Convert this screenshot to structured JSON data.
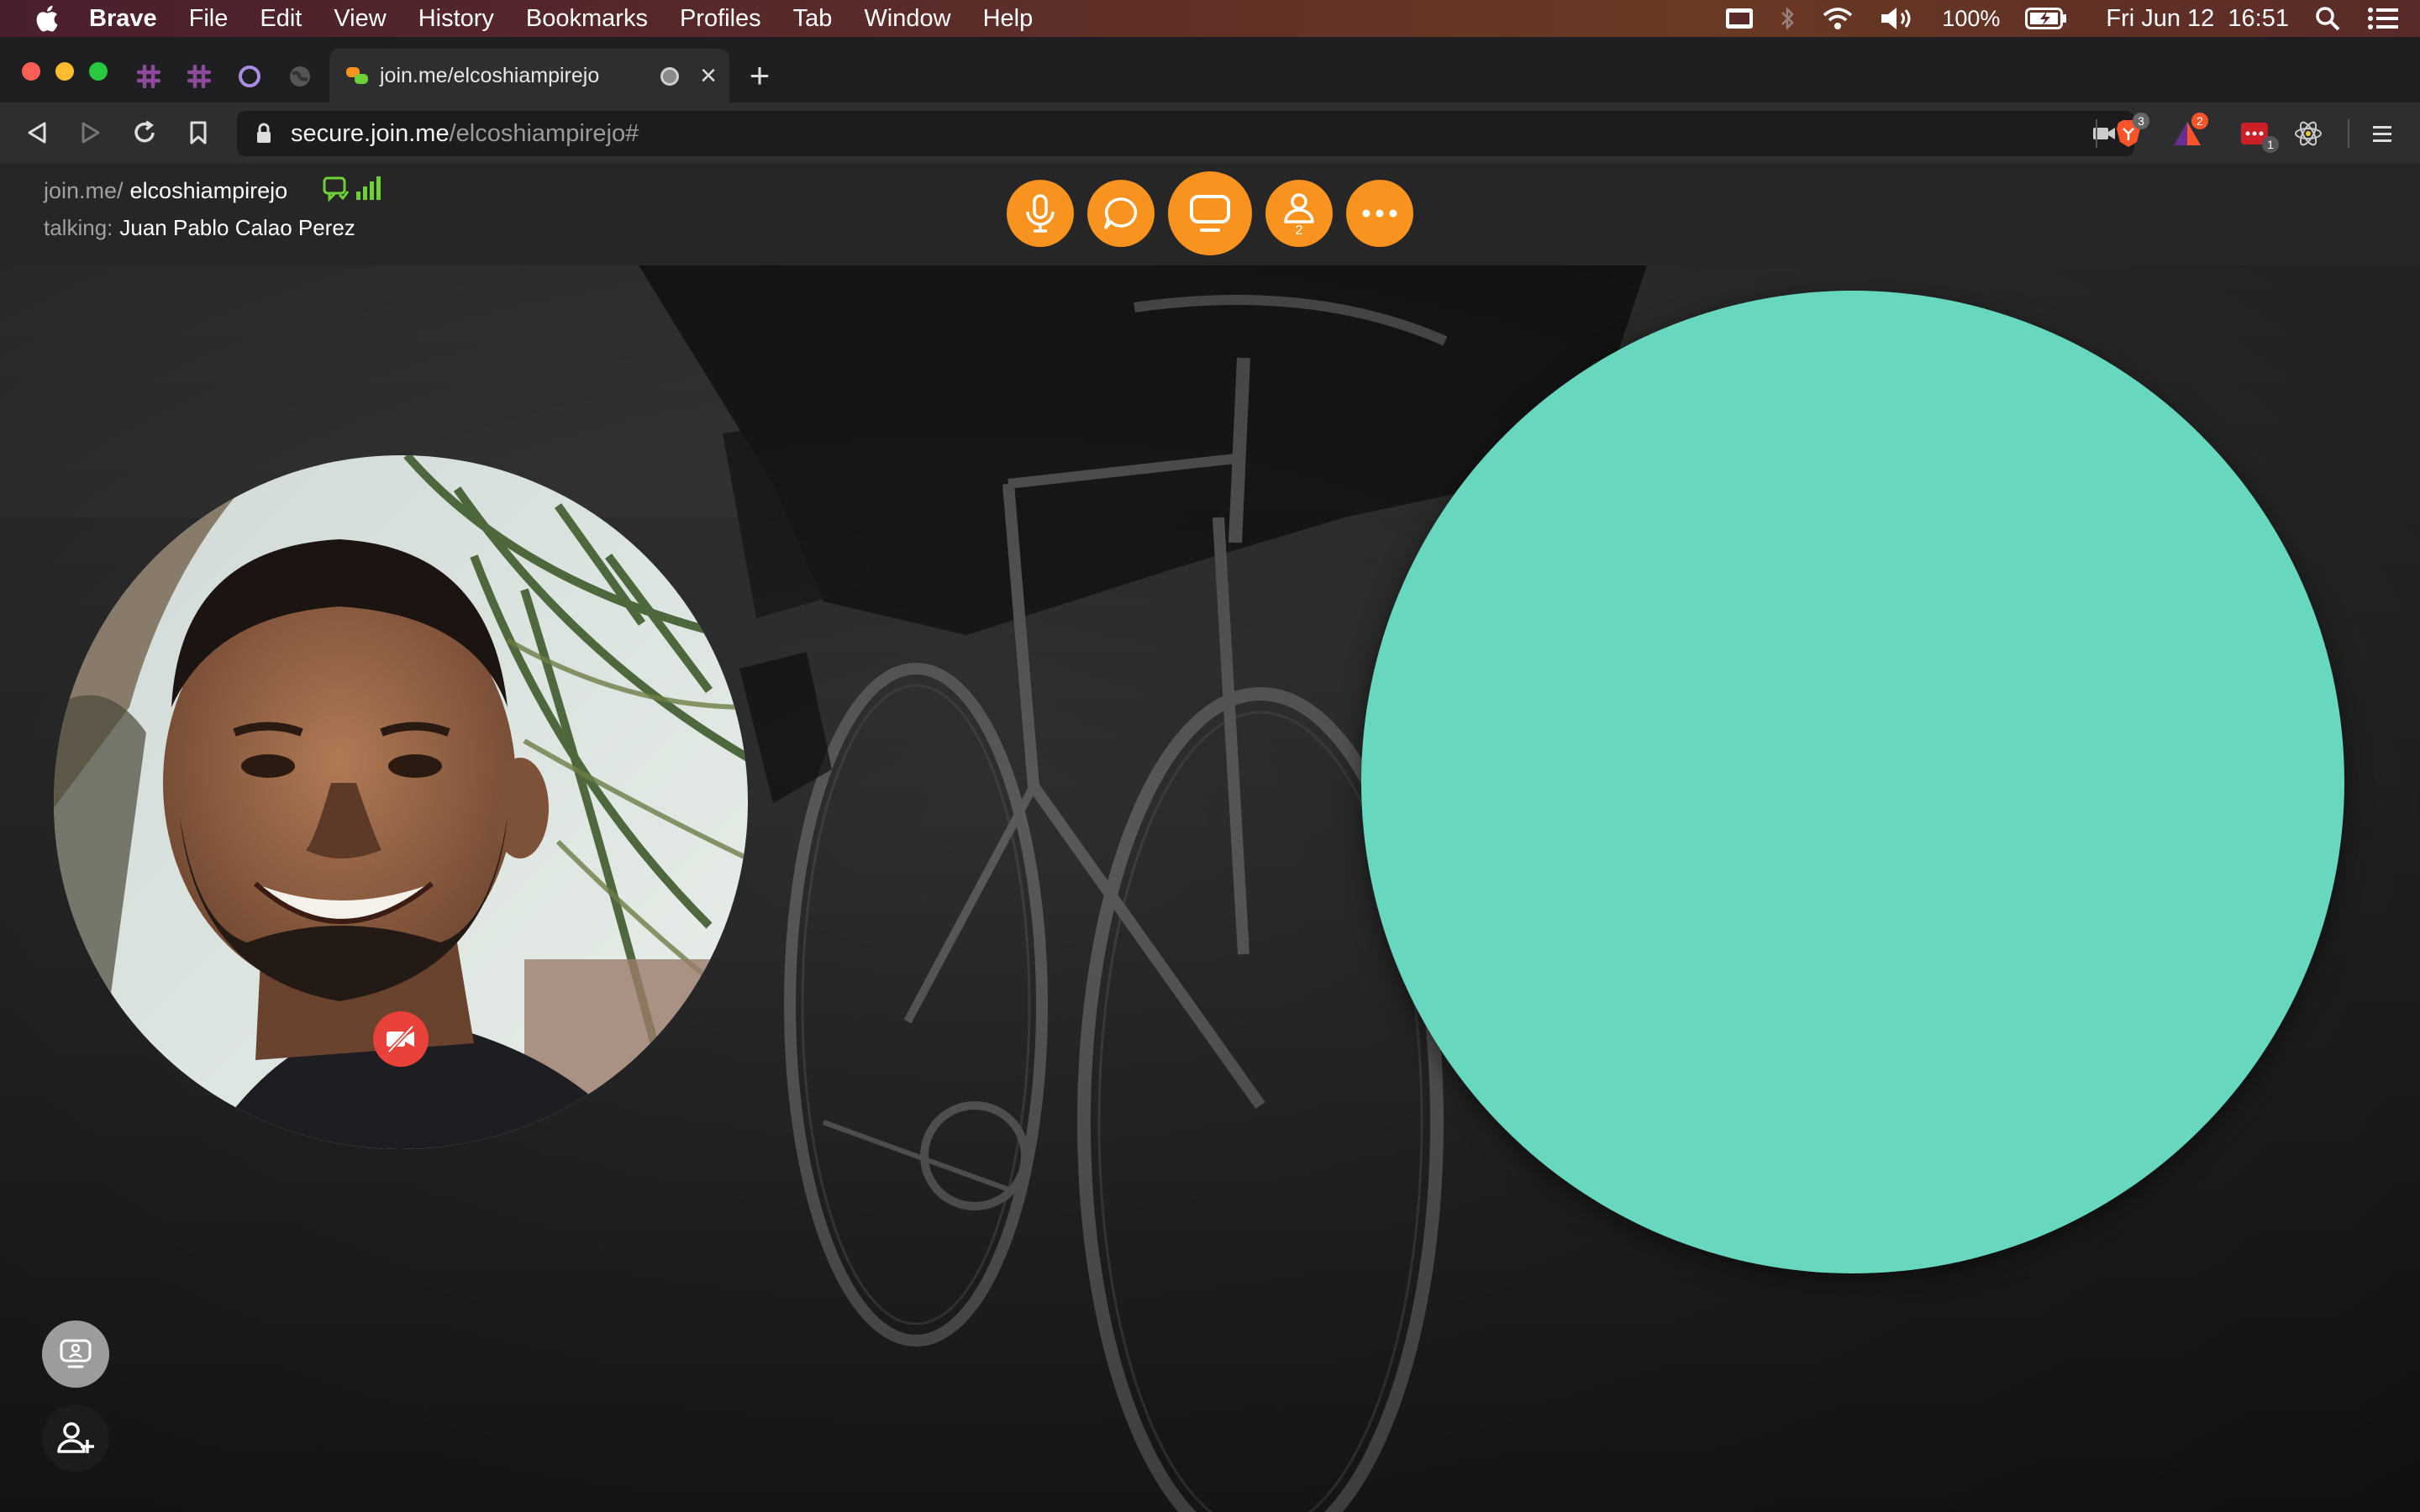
{
  "menubar": {
    "items": [
      "Brave",
      "File",
      "Edit",
      "View",
      "History",
      "Bookmarks",
      "Profiles",
      "Tab",
      "Window",
      "Help"
    ],
    "battery": "100%",
    "datetime": "Fri Jun 12  16:51"
  },
  "tab": {
    "title": "join.me/elcoshiampirejo",
    "new_tab_label": "+",
    "close_label": "×"
  },
  "address": {
    "host": "secure.join.me",
    "path": "/elcoshiampirejo#"
  },
  "extensions": {
    "brave_shields_count": "3",
    "brave_rewards_count": "2",
    "ext3_count": "1"
  },
  "meeting": {
    "url_prefix": "join.me/",
    "room": "elcoshiampirejo",
    "talking_label": "talking:",
    "talking_name": "Juan Pablo Calao Perez",
    "participant_count": "2"
  },
  "colors": {
    "accent": "#f7931e",
    "teal": "#67d8bf",
    "cam_off": "#e8423a",
    "signal": "#6fd13a"
  }
}
